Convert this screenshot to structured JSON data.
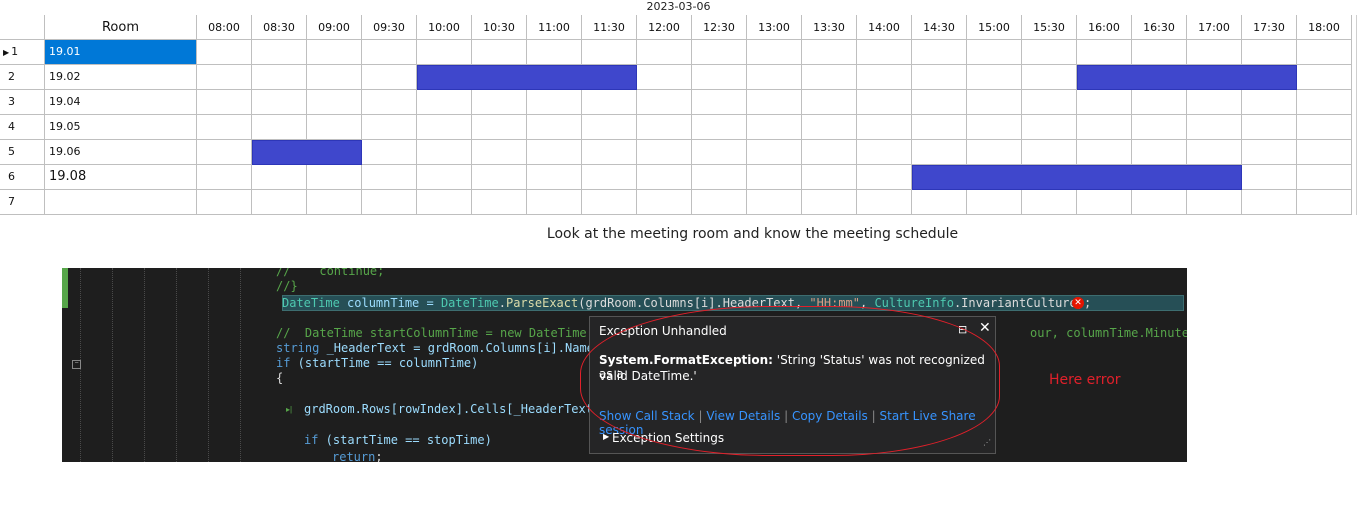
{
  "grid": {
    "date": "2023-03-06",
    "room_header": "Room",
    "times": [
      "08:00",
      "08:30",
      "09:00",
      "09:30",
      "10:00",
      "10:30",
      "11:00",
      "11:30",
      "12:00",
      "12:30",
      "13:00",
      "13:30",
      "14:00",
      "14:30",
      "15:00",
      "15:30",
      "16:00",
      "16:30",
      "17:00",
      "17:30",
      "18:00"
    ],
    "rows": [
      {
        "num": "1",
        "room": "19.01",
        "selected": true
      },
      {
        "num": "2",
        "room": "19.02"
      },
      {
        "num": "3",
        "room": "19.04"
      },
      {
        "num": "4",
        "room": "19.05"
      },
      {
        "num": "5",
        "room": "19.06"
      },
      {
        "num": "6",
        "room": "19.08"
      },
      {
        "num": "7",
        "room": ""
      }
    ],
    "bookings": [
      {
        "row": 2,
        "start": "10:00",
        "end": "12:00"
      },
      {
        "row": 2,
        "start": "16:00",
        "end": "18:00"
      },
      {
        "row": 5,
        "start": "08:30",
        "end": "09:30"
      },
      {
        "row": 6,
        "start": "14:30",
        "end": "17:30"
      }
    ],
    "booking_color": "#3f47cc",
    "selected_color": "#0078d7"
  },
  "caption": "Look at the meeting room and know the meeting schedule",
  "editor": {
    "line1": "//    continue;",
    "line2": "//}",
    "line3a": "DateTime",
    "line3b": " columnTime = ",
    "line3c": "DateTime",
    "line3d": ".",
    "line3e": "ParseExact",
    "line3f": "(grdRoom.Columns[i].HeaderText, ",
    "line3g": "\"HH:mm\"",
    "line3h": ", ",
    "line3i": "CultureInfo",
    "line3j": ".InvariantCulture);",
    "line4a": "//  DateTime startColumnTime = new DateTime(s",
    "line4b": "our, columnTime.Minute, 0);",
    "line5a": "string",
    "line5b": " _HeaderText = grdRoom.Columns[i].Name.",
    "line6a": "if",
    "line6b": " (startTime == columnTime)",
    "line7": "{",
    "line8": "grdRoom.Rows[rowIndex].Cells[_HeaderText]",
    "line9a": "if",
    "line9b": " (startTime == stopTime)",
    "line10a": "return",
    "line10b": ";"
  },
  "popup": {
    "title": "Exception Unhandled",
    "exception_type": "System.FormatException:",
    "message_1": " 'String 'Status' was not recognized as a",
    "message_2": "valid DateTime.'",
    "link_call_stack": "Show Call Stack",
    "link_view": "View Details",
    "link_copy": "Copy Details",
    "link_live": "Start Live Share session",
    "separator": "|",
    "settings": "Exception Settings",
    "pin": "⊟",
    "close": "✕"
  },
  "annotation": "Here error",
  "error_glyph": "✕",
  "row_pointer": "▶"
}
